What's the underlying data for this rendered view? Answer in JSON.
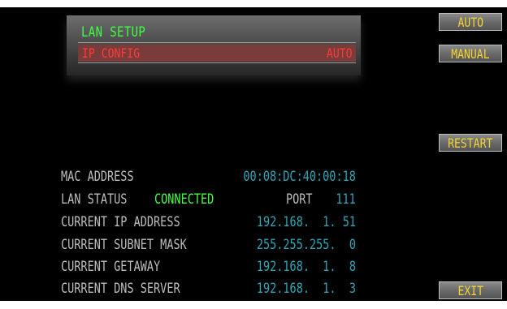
{
  "header": {
    "title": "LAN SETUP",
    "ip_config_label": "IP CONFIG",
    "ip_config_value": "AUTO"
  },
  "buttons": {
    "auto": "AUTO",
    "manual": "MANUAL",
    "restart": "RESTART",
    "exit": "EXIT"
  },
  "info": {
    "mac_label": "MAC ADDRESS",
    "mac_value": "00:08:DC:40:00:18",
    "lan_status_label": "LAN STATUS",
    "lan_status_value": "CONNECTED",
    "port_label": "PORT",
    "port_value": "111",
    "ip_label": "CURRENT IP ADDRESS",
    "ip_value": "192.168.  1. 51",
    "subnet_label": "CURRENT SUBNET MASK",
    "subnet_value": "255.255.255.  0",
    "gateway_label": "CURRENT GETAWAY",
    "gateway_value": "192.168.  1.  8",
    "dns_label": "CURRENT DNS SERVER",
    "dns_value": "192.168.  1.  3"
  },
  "colors": {
    "title": "#41ff41",
    "ip_config": "#ff3b3b",
    "button_text": "#f3d430",
    "label": "#bdbdbd",
    "value": "#2fa6b8",
    "connected": "#41ff41"
  }
}
